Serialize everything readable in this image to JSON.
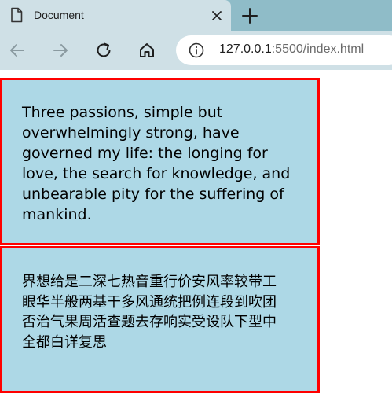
{
  "browser": {
    "tab_title": "Document",
    "url_host": "127.0.0.1",
    "url_rest": ":5500/index.html"
  },
  "content": {
    "box1_text": "Three passions, simple but overwhelmingly strong, have governed my life: the longing for love, the search for knowledge, and unbearable pity for the suffering of mankind.",
    "box2_text": "界想给是二深七热音重行价安风率较带工眼华半般两基干多风通统把例连段到吹团否治气果周活查题去存响实受设队下型中全都白详复思"
  },
  "colors": {
    "box_background": "#add8e6",
    "box_border": "#ff0000"
  },
  "icons": [
    "document-icon",
    "close-icon",
    "plus-icon",
    "back-arrow-icon",
    "forward-arrow-icon",
    "reload-icon",
    "home-icon",
    "info-icon"
  ]
}
